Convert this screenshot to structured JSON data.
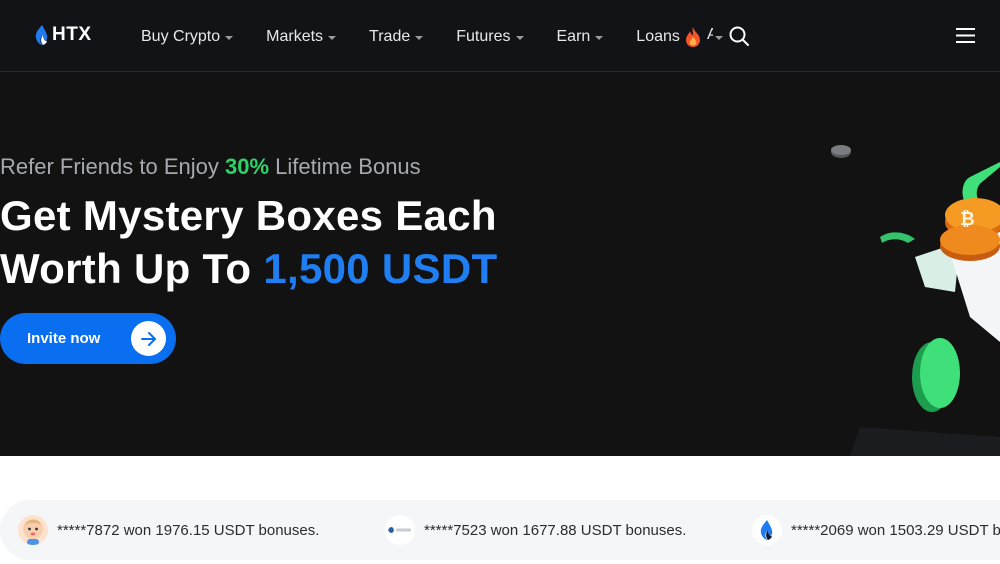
{
  "nav": {
    "logo_text": "HTX",
    "items": [
      {
        "label": "Buy Crypto"
      },
      {
        "label": "Markets"
      },
      {
        "label": "Trade"
      },
      {
        "label": "Futures"
      },
      {
        "label": "Earn"
      },
      {
        "label": "Loans"
      }
    ],
    "truncated_item": "A"
  },
  "hero": {
    "subtitle_pre": "Refer Friends to Enjoy ",
    "subtitle_highlight": "30%",
    "subtitle_post": " Lifetime Bonus",
    "headline_line1": "Get Mystery Boxes Each",
    "headline_line2_pre": "Worth Up To ",
    "headline_line2_highlight": "1,500 USDT",
    "cta_label": "Invite now"
  },
  "ticker": [
    {
      "text": "*****7872 won 1976.15 USDT bonuses.",
      "avatar": "baby-avatar-icon"
    },
    {
      "text": "*****7523 won 1677.88 USDT bonuses.",
      "avatar": "brand-avatar-icon"
    },
    {
      "text": "*****2069 won 1503.29 USDT b",
      "avatar": "htx-flame-avatar-icon"
    }
  ],
  "colors": {
    "accent_blue": "#1f7ff2",
    "accent_green": "#2fd269",
    "button_blue": "#0a6ef0",
    "background": "#121212"
  }
}
